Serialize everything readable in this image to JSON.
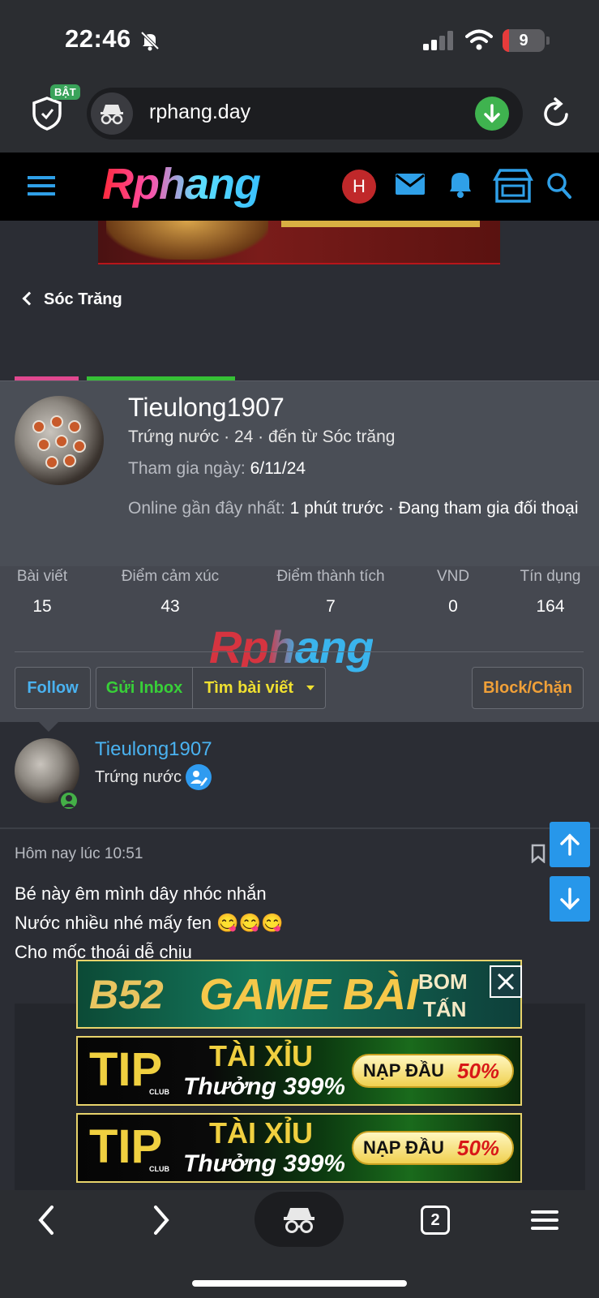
{
  "status_bar": {
    "time": "22:46",
    "battery": "9"
  },
  "browser": {
    "shield_badge": "BẬT",
    "url": "rphang.day",
    "tabs_count": "2"
  },
  "forum": {
    "logo": "Rphang",
    "user_initial": "H"
  },
  "breadcrumb": {
    "back_label": "Sóc Trăng"
  },
  "profile": {
    "name": "Tieulong1907",
    "subtitle": "Trứng nước · 24 · đến từ Sóc trăng",
    "joined_label": "Tham gia ngày:",
    "joined_value": "6/11/24",
    "online_label": "Online gần đây nhất:",
    "online_value": "1 phút trước · Đang tham gia đối thoại",
    "stats": [
      {
        "label": "Bài viết",
        "value": "15"
      },
      {
        "label": "Điểm cảm xúc",
        "value": "43"
      },
      {
        "label": "Điểm thành tích",
        "value": "7"
      },
      {
        "label": "VND",
        "value": "0"
      },
      {
        "label": "Tín dụng",
        "value": "164"
      }
    ],
    "buttons": {
      "follow": "Follow",
      "inbox": "Gửi Inbox",
      "find_posts": "Tìm bài viết",
      "block": "Block/Chặn"
    },
    "watermark": "Rphang"
  },
  "post": {
    "author": "Tieulong1907",
    "rank": "Trứng nước",
    "time": "Hôm nay lúc 10:51",
    "line1": "Bé này êm mình dây nhóc nhắn",
    "line2": "Nước nhiều nhé mấy fen 😋😋😋",
    "line3": "Cho mốc thoái dễ chịu"
  },
  "ads": {
    "b52": {
      "brand": "B52",
      "title": "GAME BÀI",
      "tag1": "BOM",
      "tag2": "TẤN"
    },
    "tip": {
      "brand": "TIP",
      "club": "CLUB",
      "title": "TÀI XỈU",
      "bonus": "Thưởng 399%",
      "promo_a": "NẠP ĐẦU",
      "promo_b": "50%"
    }
  },
  "colors": {
    "accent_blue": "#4ab2f0",
    "follow": "#4ab2f0",
    "inbox": "#38d038",
    "find": "#f0e030",
    "block": "#f0a038",
    "scroll_btn": "#2797ea"
  }
}
